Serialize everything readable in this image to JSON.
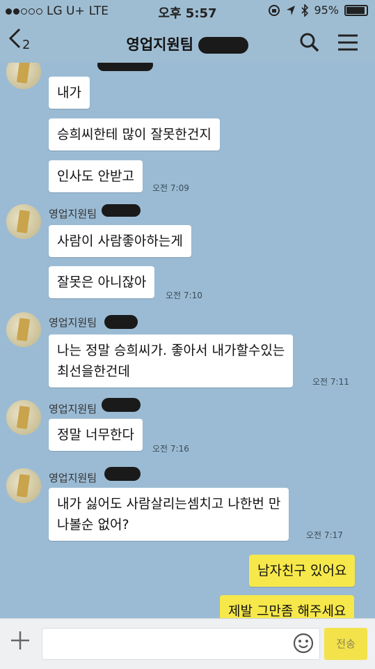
{
  "status_bar": {
    "carrier": "LG U+",
    "network": "LTE",
    "time": "오후 5:57",
    "battery": "95%"
  },
  "header": {
    "back_count": "2",
    "title": "영업지원팀"
  },
  "messages": [
    {
      "type": "received-continued",
      "text": "내가"
    },
    {
      "type": "received-continued",
      "text": "승희씨한테 많이 잘못한건지"
    },
    {
      "type": "received-continued",
      "text": "인사도 안받고",
      "time": "오전 7:09"
    },
    {
      "sender": "영업지원팀",
      "text": "사람이 사람좋아하는게"
    },
    {
      "type": "received-continued",
      "text": "잘못은 아니잖아",
      "time": "오전 7:10"
    },
    {
      "sender": "영업지원팀",
      "lines": [
        "나는 정말 승희씨가. 좋아서 내가할수있는",
        "최선을한건데"
      ],
      "time": "오전 7:11"
    },
    {
      "sender": "영업지원팀",
      "text": "정말 너무한다",
      "time": "오전 7:16"
    },
    {
      "sender": "영업지원팀",
      "lines": [
        "내가 싫어도 사람살리는셈치고 나한번 만",
        "나볼순 없어?"
      ],
      "time": "오전 7:17"
    },
    {
      "type": "sent",
      "text": "남자친구 있어요"
    },
    {
      "type": "sent",
      "text": "제발 그만좀 해주세요"
    }
  ],
  "input": {
    "send_label": "전송"
  },
  "colors": {
    "background": "#9bbbd4",
    "sent_bubble": "#f6e84a",
    "received_bubble": "#ffffff"
  }
}
